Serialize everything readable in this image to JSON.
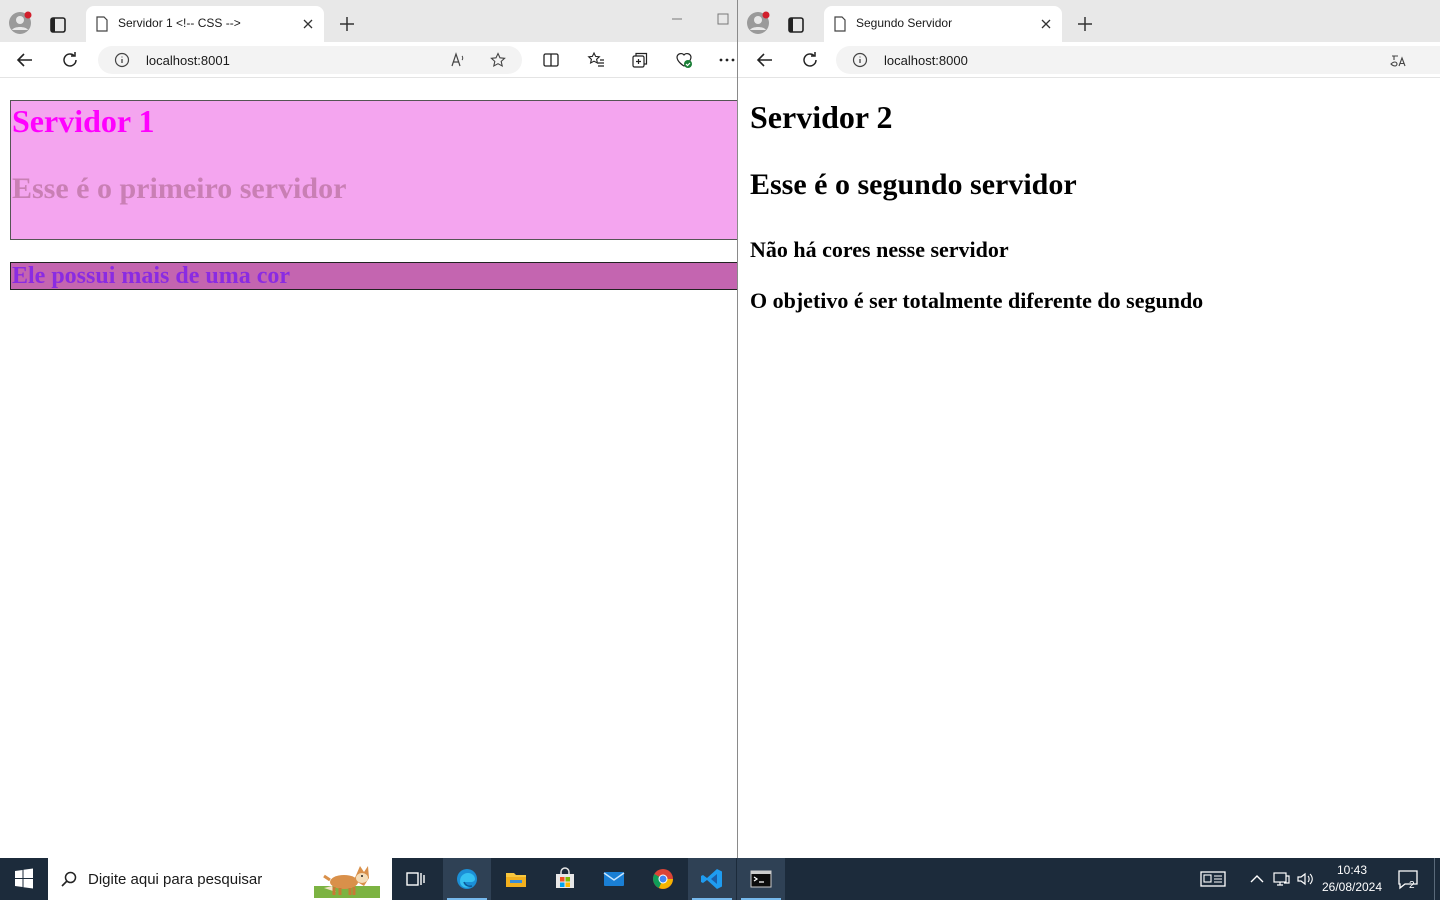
{
  "left_window": {
    "tab_title": "Servidor 1 <!-- CSS -->",
    "url": "localhost:8001",
    "page": {
      "heading": "Servidor 1",
      "subheading": "Esse é o primeiro servidor",
      "colored_line": "Ele possui mais de uma cor"
    },
    "colors": {
      "box1_bg": "#f4a5ef",
      "heading": "#ff00ff",
      "subheading": "#c97fb4",
      "box2_bg": "#c465b0",
      "colored_line": "#8a2be2"
    }
  },
  "right_window": {
    "tab_title": "Segundo Servidor",
    "url": "localhost:8000",
    "page": {
      "heading": "Servidor 2",
      "subheading": "Esse é o segundo servidor",
      "line1": "Não há cores nesse servidor",
      "line2": "O objetivo é ser totalmente diferente do segundo"
    }
  },
  "taskbar": {
    "search_placeholder": "Digite aqui para pesquisar",
    "apps": [
      "task-view",
      "edge",
      "file-explorer",
      "microsoft-store",
      "mail",
      "chrome",
      "vscode",
      "terminal"
    ],
    "time": "10:43",
    "date": "26/08/2024",
    "notification_count": "2"
  }
}
